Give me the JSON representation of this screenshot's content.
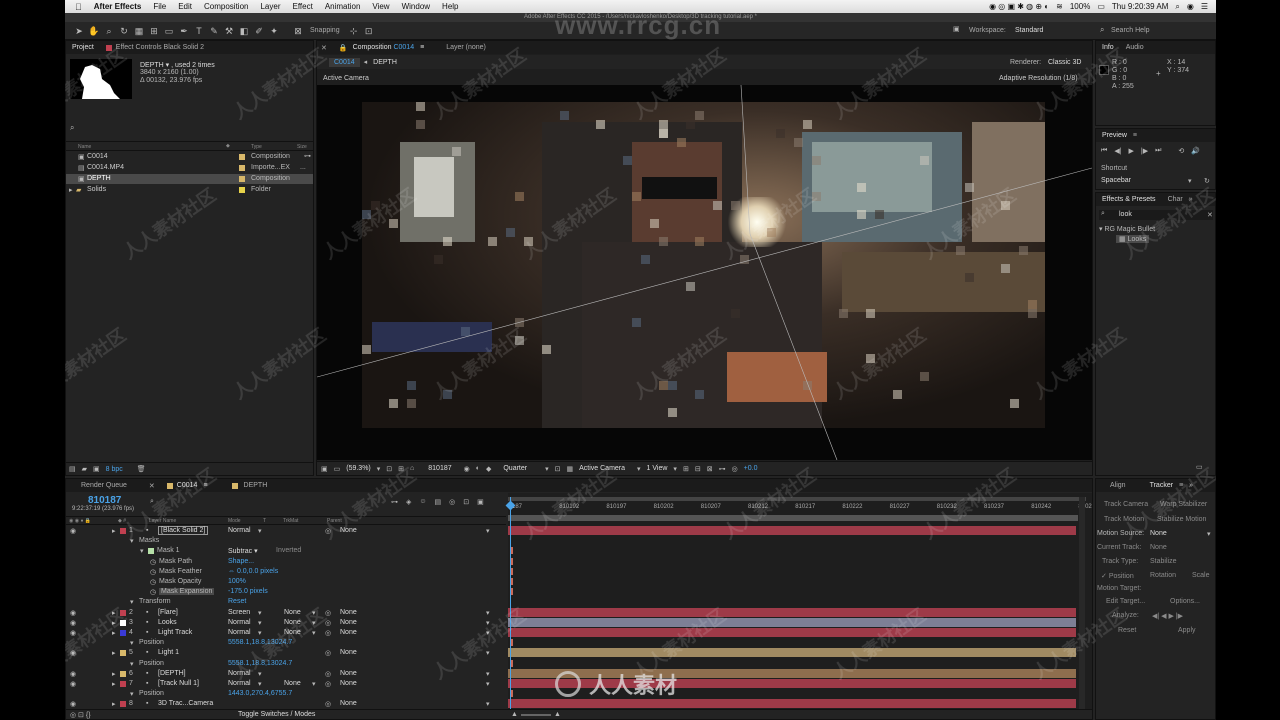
{
  "menubar": {
    "app_name": "After Effects",
    "items": [
      "File",
      "Edit",
      "Composition",
      "Layer",
      "Effect",
      "Animation",
      "View",
      "Window",
      "Help"
    ],
    "battery": "100%",
    "clock": "Thu 9:20:39 AM"
  },
  "titlebar": {
    "text": "Adobe After Effects CC 2015 - /Users/nickavloshenko/Desktop/3D tracking tutorial.aep *"
  },
  "toolbar": {
    "snapping": "Snapping",
    "workspace_label": "Workspace:",
    "workspace_value": "Standard",
    "search_help": "Search Help"
  },
  "project": {
    "tab_project": "Project",
    "tab_effect_controls": "Effect Controls Black Solid 2",
    "selected_name": "DEPTH ▾ , used 2 times",
    "selected_res": "3840 x 2160 (1.00)",
    "selected_dur": "Δ 00132, 23.976 fps",
    "search_placeholder": "",
    "col_name": "Name",
    "col_type": "Type",
    "col_size": "Size",
    "items": [
      {
        "name": "C0014",
        "type": "Composition",
        "color": "#d8b86a",
        "selected": false
      },
      {
        "name": "C0014.MP4",
        "type": "Importe...EX",
        "color": "#d8b86a",
        "selected": false
      },
      {
        "name": "DEPTH",
        "type": "Composition",
        "color": "#d8b86a",
        "selected": true
      },
      {
        "name": "Solids",
        "type": "Folder",
        "color": "#e6d24a",
        "selected": false
      }
    ],
    "bpc": "8 bpc"
  },
  "composition": {
    "tab_comp": "Composition",
    "tab_comp_name": "C0014",
    "tab_layer": "Layer (none)",
    "crumb_1": "C0014",
    "crumb_2": "DEPTH",
    "renderer_label": "Renderer:",
    "renderer_value": "Classic 3D",
    "active_camera": "Active Camera",
    "adaptive": "Adaptive Resolution (1/8)",
    "zoom": "(59.3%)",
    "timecode": "810187",
    "quality": "Quarter",
    "camera": "Active Camera",
    "view": "1 View",
    "exposure": "+0.0"
  },
  "info": {
    "tab_info": "Info",
    "tab_audio": "Audio",
    "r": "R : 0",
    "g": "G : 0",
    "b": "B : 0",
    "a": "A : 255",
    "x": "X : 14",
    "y": "Y : 374"
  },
  "preview": {
    "title": "Preview",
    "shortcut_label": "Shortcut",
    "shortcut_value": "Spacebar"
  },
  "effects": {
    "tab_effects": "Effects & Presets",
    "tab_char": "Char",
    "search_value": "look",
    "group": "RG Magic Bullet",
    "item": "Looks"
  },
  "timeline": {
    "tab_render": "Render Queue",
    "tab_c0014": "C0014",
    "tab_depth": "DEPTH",
    "timecode": "810187",
    "timecode_sub": "9:22:37:19 (23.976 fps)",
    "col_layer": "Layer Name",
    "col_mode": "Mode",
    "col_trkmat": "TrkMat",
    "col_parent": "Parent",
    "ruler": [
      "187",
      "810192",
      "810197",
      "810202",
      "810207",
      "810212",
      "810217",
      "810222",
      "810227",
      "810232",
      "810237",
      "810242",
      "8102"
    ],
    "footer": "Toggle Switches / Modes",
    "rows": [
      {
        "kind": "layer",
        "num": "1",
        "name": "[Black Solid 2]",
        "mode": "Normal",
        "trkmat": "",
        "parent": "None",
        "color": "#c04050",
        "bar": "#9e3a48",
        "boxed": true
      },
      {
        "kind": "prop",
        "indent": 1,
        "name": "Masks"
      },
      {
        "kind": "prop",
        "indent": 2,
        "name": "Mask 1",
        "value": "Subtrac ▾",
        "extra": "Inverted",
        "chip": "#b6e0a8"
      },
      {
        "kind": "prop",
        "indent": 3,
        "name": "Mask Path",
        "value": "Shape..."
      },
      {
        "kind": "prop",
        "indent": 3,
        "name": "Mask Feather",
        "value": "⇔ 0.0,0.0 pixels"
      },
      {
        "kind": "prop",
        "indent": 3,
        "name": "Mask Opacity",
        "value": "100%"
      },
      {
        "kind": "prop",
        "indent": 3,
        "name": "Mask Expansion",
        "value": "-175.0 pixels",
        "hl": true
      },
      {
        "kind": "prop",
        "indent": 1,
        "name": "Transform",
        "value": "Reset"
      },
      {
        "kind": "layer",
        "num": "2",
        "name": "[Flare]",
        "mode": "Screen",
        "trkmat": "None",
        "parent": "None",
        "color": "#c04050",
        "bar": "#9e3a48"
      },
      {
        "kind": "layer",
        "num": "3",
        "name": "Looks",
        "mode": "Normal",
        "trkmat": "None",
        "parent": "None",
        "color": "#ffffff",
        "bar": "#7d7f95"
      },
      {
        "kind": "layer",
        "num": "4",
        "name": "Light Track",
        "mode": "Normal",
        "trkmat": "None",
        "parent": "None",
        "color": "#3a3ad6",
        "bar": "#9e3a48"
      },
      {
        "kind": "prop",
        "indent": 1,
        "name": "Position",
        "value": "5558.1,18.8,13024.7"
      },
      {
        "kind": "layer",
        "num": "5",
        "name": "Light 1",
        "mode": "",
        "trkmat": "",
        "parent": "None",
        "color": "#d8b86a",
        "bar": "#a08a62"
      },
      {
        "kind": "prop",
        "indent": 1,
        "name": "Position",
        "value": "5558.1,18.8,13024.7"
      },
      {
        "kind": "layer",
        "num": "6",
        "name": "[DEPTH]",
        "mode": "Normal",
        "trkmat": "",
        "parent": "None",
        "color": "#d8b86a",
        "bar": "#8e6e4e"
      },
      {
        "kind": "layer",
        "num": "7",
        "name": "[Track Null 1]",
        "mode": "Normal",
        "trkmat": "None",
        "parent": "None",
        "color": "#c04050",
        "bar": "#9e3a48"
      },
      {
        "kind": "prop",
        "indent": 1,
        "name": "Position",
        "value": "1443.0,270.4,6755.7"
      },
      {
        "kind": "layer",
        "num": "8",
        "name": "3D Trac...Camera",
        "mode": "",
        "trkmat": "",
        "parent": "None",
        "color": "#c04050",
        "bar": "#9e3a48"
      }
    ]
  },
  "tracker": {
    "tab_align": "Align",
    "tab_tracker": "Tracker",
    "track_camera": "Track Camera",
    "warp_stabilizer": "Warp Stabilizer",
    "track_motion": "Track Motion",
    "stabilize_motion": "Stabilize Motion",
    "motion_source_label": "Motion Source:",
    "motion_source_value": "None",
    "current_track_label": "Current Track:",
    "current_track_value": "None",
    "track_type_label": "Track Type:",
    "track_type_value": "Stabilize",
    "position": "Position",
    "rotation": "Rotation",
    "scale": "Scale",
    "motion_target": "Motion Target:",
    "edit_target": "Edit Target...",
    "options": "Options...",
    "analyze": "Analyze:",
    "reset": "Reset",
    "apply": "Apply"
  },
  "watermark": {
    "top": "www.rrcg.cn",
    "bottom": "人人素材",
    "tiles": "人人素材社区"
  }
}
